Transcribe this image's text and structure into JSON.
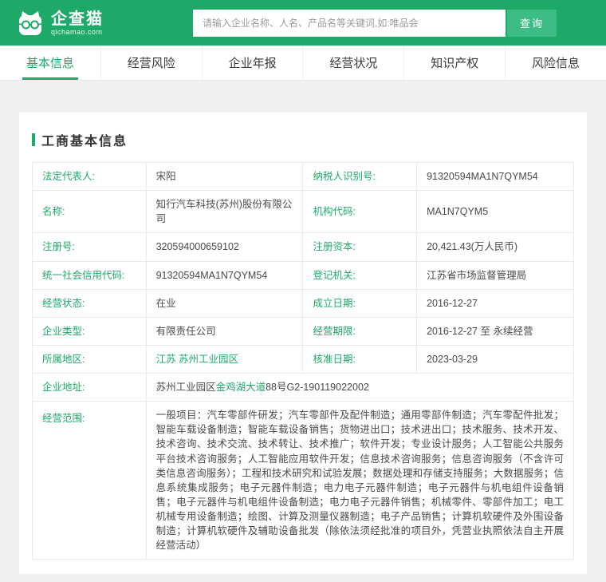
{
  "header": {
    "logo_title": "企查猫",
    "logo_subtitle": "qichamao.com",
    "search_placeholder": "请输入企业名称、人名、产品名等关键词,如:唯品会",
    "search_button": "查询"
  },
  "nav": {
    "tabs": [
      {
        "label": "基本信息",
        "active": true
      },
      {
        "label": "经营风险",
        "active": false
      },
      {
        "label": "企业年报",
        "active": false
      },
      {
        "label": "经营状况",
        "active": false
      },
      {
        "label": "知识产权",
        "active": false
      },
      {
        "label": "风险信息",
        "active": false
      }
    ]
  },
  "section": {
    "title": "工商基本信息"
  },
  "fields": {
    "legal_rep_label": "法定代表人:",
    "legal_rep": "宋阳",
    "taxpayer_id_label": "纳税人识别号:",
    "taxpayer_id": "91320594MA1N7QYM54",
    "name_label": "名称:",
    "name": "知行汽车科技(苏州)股份有限公司",
    "org_code_label": "机构代码:",
    "org_code": "MA1N7QYM5",
    "reg_no_label": "注册号:",
    "reg_no": "320594000659102",
    "reg_capital_label": "注册资本:",
    "reg_capital": "20,421.43(万人民币)",
    "credit_code_label": "统一社会信用代码:",
    "credit_code": "91320594MA1N7QYM54",
    "reg_authority_label": "登记机关:",
    "reg_authority": "江苏省市场监督管理局",
    "status_label": "经营状态:",
    "status": "在业",
    "established_label": "成立日期:",
    "established": "2016-12-27",
    "company_type_label": "企业类型:",
    "company_type": "有限责任公司",
    "term_label": "经营期限:",
    "term": "2016-12-27 至 永续经营",
    "region_label": "所属地区:",
    "region": "江苏 苏州工业园区",
    "approval_date_label": "核准日期:",
    "approval_date": "2023-03-29",
    "address_label": "企业地址:",
    "address_prefix": "苏州工业园区",
    "address_link": "金鸡湖大道",
    "address_suffix": "88号G2-190119022002",
    "scope_label": "经营范围:",
    "scope": "一般项目：汽车零部件研发；汽车零部件及配件制造；通用零部件制造；汽车零配件批发；智能车载设备制造；智能车载设备销售；货物进出口；技术进出口；技术服务、技术开发、技术咨询、技术交流、技术转让、技术推广；软件开发；专业设计服务；人工智能公共服务平台技术咨询服务；人工智能应用软件开发；信息技术咨询服务；信息咨询服务（不含许可类信息咨询服务）；工程和技术研究和试验发展；数据处理和存储支持服务；大数据服务；信息系统集成服务；电子元器件制造；电力电子元器件制造；电子元器件与机电组件设备销售；电子元器件与机电组件设备制造；电力电子元器件销售；机械零件、零部件加工；电工机械专用设备制造；绘图、计算及测量仪器制造；电子产品销售；计算机软硬件及外围设备制造；计算机软硬件及辅助设备批发（除依法须经批准的项目外，凭营业执照依法自主开展经营活动）"
  },
  "colors": {
    "brand_green": "#1ea969",
    "button_green": "#3cbd85",
    "page_bg": "#f0f0f0"
  }
}
